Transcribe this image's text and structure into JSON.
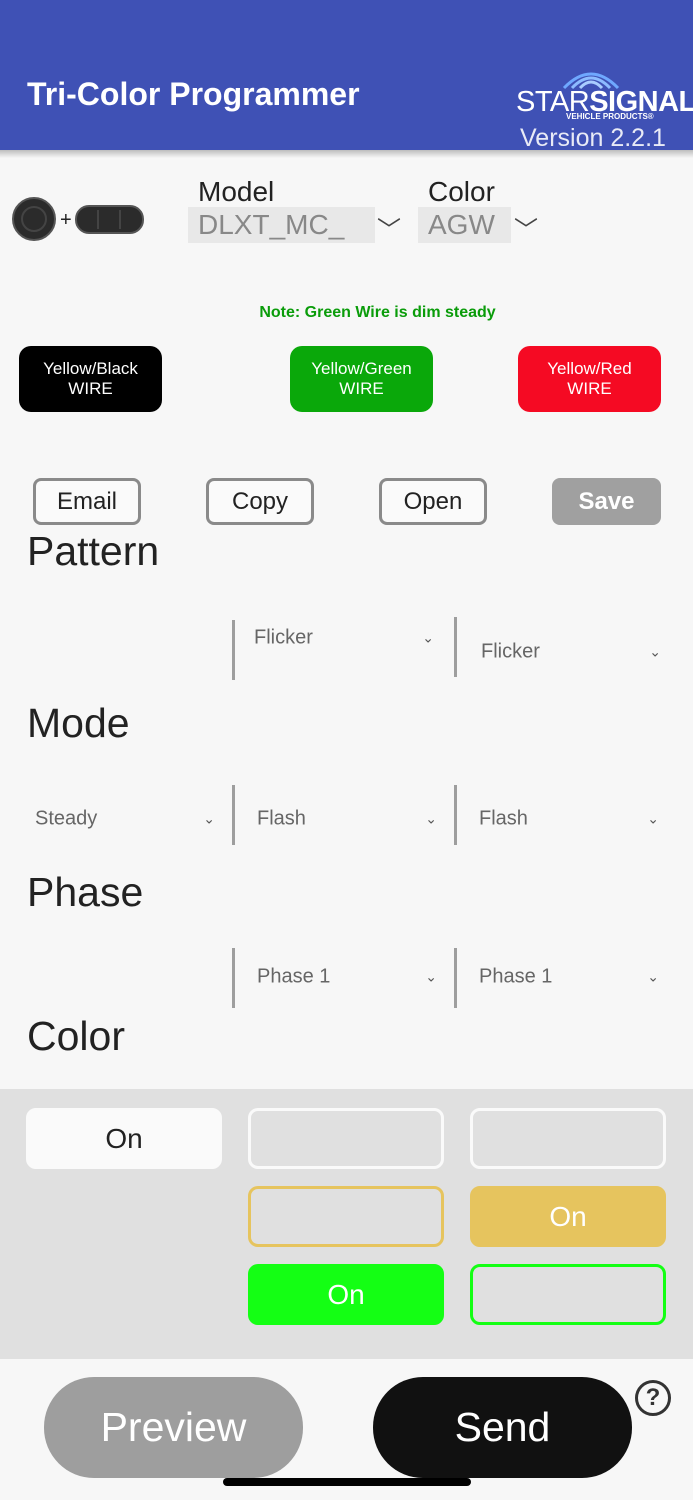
{
  "header": {
    "title": "Tri-Color Programmer",
    "logo_left": "STAR",
    "logo_right": "SIGNAL",
    "logo_sub": "VEHICLE PRODUCTS®",
    "version": "Version 2.2.1",
    "bg_color": "#3f51b5"
  },
  "device": {
    "icon": "device-light-plus-bar-icon",
    "plus": "+"
  },
  "model": {
    "label": "Model",
    "value": "DLXT_MC_"
  },
  "color_select": {
    "label": "Color",
    "value": "AGW"
  },
  "note": "Note: Green Wire is dim steady",
  "wires": [
    {
      "line1": "Yellow/Black",
      "line2": "WIRE",
      "color": "#000000"
    },
    {
      "line1": "Yellow/Green",
      "line2": "WIRE",
      "color": "#0aa80a"
    },
    {
      "line1": "Yellow/Red",
      "line2": "WIRE",
      "color": "#f50a23"
    }
  ],
  "actions": {
    "email": "Email",
    "copy": "Copy",
    "open": "Open",
    "save": "Save"
  },
  "sections": {
    "pattern": "Pattern",
    "mode": "Mode",
    "phase": "Phase",
    "color": "Color"
  },
  "pattern": {
    "col2": "Flicker",
    "col3": "Flicker"
  },
  "mode": {
    "col1": "Steady",
    "col2": "Flash",
    "col3": "Flash"
  },
  "phase": {
    "col2": "Phase 1",
    "col3": "Phase 1"
  },
  "color_grid": {
    "white_on": "On",
    "amber_on": "On",
    "green_on": "On",
    "white": "#fafafa",
    "amber": "#e6c45e",
    "green": "#14ff14"
  },
  "bottom": {
    "preview": "Preview",
    "send": "Send",
    "help": "?"
  }
}
